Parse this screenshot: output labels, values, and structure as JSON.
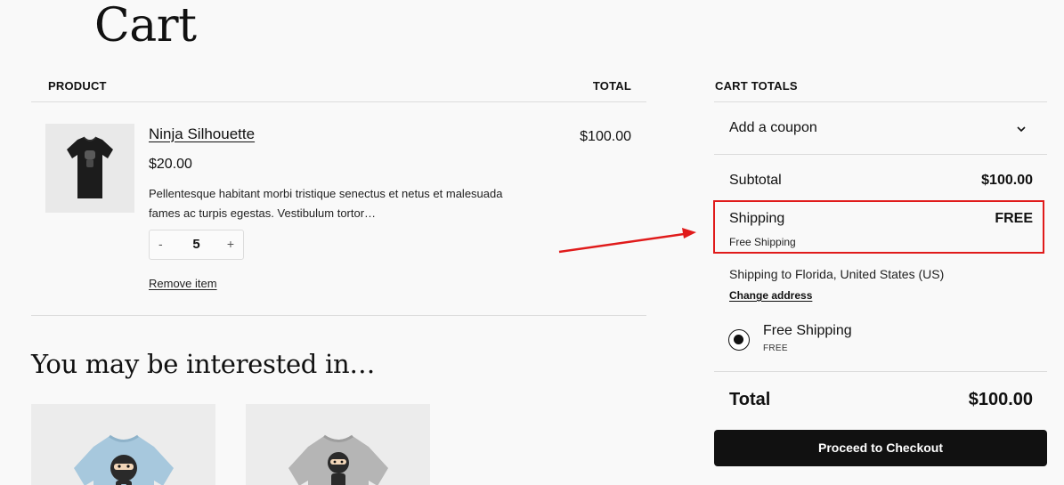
{
  "page": {
    "title": "Cart"
  },
  "cart_table": {
    "col_product": "PRODUCT",
    "col_total": "TOTAL",
    "items": [
      {
        "name": "Ninja Silhouette",
        "price": "$20.00",
        "description": "Pellentesque habitant morbi tristique senectus et netus et malesuada fames ac turpis egestas. Vestibulum tortor…",
        "quantity": "5",
        "qty_minus": "-",
        "qty_plus": "+",
        "line_total": "$100.00",
        "remove_label": "Remove item",
        "thumbnail_icon": "black-tshirt-image"
      }
    ]
  },
  "recommendations": {
    "heading": "You may be interested in…",
    "items": [
      {
        "icon": "blue-ninja-tshirt-image",
        "color": "#a7c8dd"
      },
      {
        "icon": "grey-ninja-tshirt-image",
        "color": "#b5b5b5"
      }
    ]
  },
  "totals": {
    "heading": "CART TOTALS",
    "coupon_label": "Add a coupon",
    "subtotal_label": "Subtotal",
    "subtotal_value": "$100.00",
    "shipping_label": "Shipping",
    "shipping_value": "FREE",
    "shipping_method": "Free Shipping",
    "shipping_to": "Shipping to Florida, United States (US)",
    "change_address": "Change address",
    "option_label": "Free Shipping",
    "option_price": "FREE",
    "total_label": "Total",
    "total_value": "$100.00",
    "checkout_label": "Proceed to Checkout"
  },
  "colors": {
    "highlight": "#e01b1b",
    "button": "#111111",
    "background": "#f9f9f9"
  }
}
